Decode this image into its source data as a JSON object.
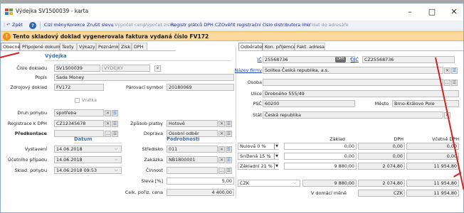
{
  "window": {
    "title": "Výdejka SV1500039 - karta",
    "minimize": "–",
    "maximize": "□",
    "close": "✕"
  },
  "toolbar": {
    "back": "Zpět",
    "help": "?",
    "items": [
      "Cizí měny",
      "Korekce",
      "Zrušit slevu",
      "Výpočet ceny",
      "Výpočet zisku",
      "Registr plátců DPH CZ",
      "Ověřit registrační číslo distributora lihu",
      "Přidat do adresáře"
    ],
    "disabled": [
      false,
      false,
      false,
      true,
      true,
      false,
      false,
      true
    ]
  },
  "info": {
    "icon": "!",
    "text": "Tento skladový doklad vygenerovala faktura vydaná číslo FV172"
  },
  "tabs": [
    "Obecné",
    "Připojené dokumenty",
    "Texty",
    "Výkazy",
    "Poznámka",
    "Zisk",
    "DPH"
  ],
  "active_tab": "Obecné",
  "vydejka": {
    "section": "Výdejka",
    "cislo_label": "Číslo dokladu",
    "cislo": "SV1500039",
    "typ": "VÝDEJKY",
    "popis_label": "Popis",
    "popis": "Sada Money",
    "zdroj_label": "Zdrojový doklad",
    "zdroj": "FV172",
    "parovaci_label": "Párovací symbol",
    "parovaci": "20180069",
    "vratka_label": "Vratka",
    "druh_label": "Druh pohybu",
    "druh": "spotřeba",
    "registrace_label": "Registrace k DPH",
    "registrace": "CZ12345678",
    "zpusob_label": "Způsob platby",
    "zpusob": "Hotově",
    "predkontace_label": "Předkontace",
    "doprava_label": "Doprava",
    "doprava": "Osobní odběr"
  },
  "partner_tabs": [
    "Odběratel",
    "Kon. příjemce",
    "Fakt. adresa"
  ],
  "partner": {
    "ic_label": "IČ",
    "ic": "25568736",
    "dph_badge": "DPH",
    "dic_label": "DIČ",
    "dic": "CZ25568736",
    "firma_label": "Název firmy",
    "firma": "Solitea Česká republika, a.s.",
    "osoba_label": "Osoba",
    "osoba": "",
    "ulice_label": "Ulice",
    "ulice": "Drobného 555/49",
    "psc_label": "PSČ",
    "psc": "60200",
    "mesto_label": "Město",
    "mesto": "Brno-Královo Pole",
    "stat_label": "Stát",
    "stat": "Česká republika"
  },
  "datum": {
    "section": "Datum",
    "vystaveni_label": "Vystavení",
    "vystaveni": "14.06.2018",
    "ucetni_label": "Účetního případu",
    "ucetni": "14.06.2018",
    "sklad_label": "Sklad. pohybu",
    "sklad": "14.06.2018   09:53"
  },
  "podrobnosti": {
    "section": "Podrobnosti",
    "stredisko_label": "Středisko",
    "stredisko": "011",
    "zakazka_label": "Zakázka",
    "zakazka": "NB1800001",
    "cinnost_label": "Činnost",
    "cinnost": "",
    "sleva_label": "Sleva [%]",
    "sleva": "5,00",
    "cena_label": "Celk. pořiz. cena",
    "cena": "4 400,00"
  },
  "vat": {
    "headers": [
      "Základ",
      "DPH",
      "Včetně DPH"
    ],
    "rows": [
      {
        "rate": "Nulová 0 %",
        "zaklad": "0,00",
        "dph": "0,00",
        "vcetne": "0,00"
      },
      {
        "rate": "Snížená 15 %",
        "zaklad": "0,00",
        "dph": "0,00",
        "vcetne": "0,00"
      },
      {
        "rate": "Základní 21 %",
        "zaklad": "9 880,00",
        "dph": "2 074,80",
        "vcetne": "11 954,80"
      }
    ],
    "total": {
      "currency": "CZK",
      "zaklad": "9 880,00",
      "dph": "2 074,80",
      "vcetne": "11 954,80"
    },
    "domestic": {
      "label": "V domácí měně",
      "currency": "CZK",
      "vcetne": "11 954,80"
    }
  },
  "colors": {
    "accent": "#3b6fb5",
    "infobar": "#fbd99e",
    "annotation": "#d12222"
  }
}
